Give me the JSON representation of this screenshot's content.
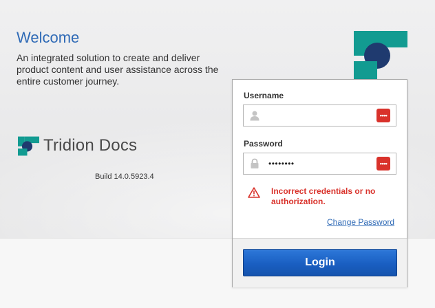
{
  "intro": {
    "title": "Welcome",
    "description": "An integrated solution to create and deliver product content and user assistance across the entire customer journey."
  },
  "brand": {
    "name": "Tridion Docs",
    "build": "Build 14.0.5923.4"
  },
  "login_form": {
    "username_label": "Username",
    "username_value": "",
    "password_label": "Password",
    "password_value": "••••••••",
    "password_manager_badge": "••••",
    "error_message": "Incorrect credentials or no authorization.",
    "change_password_link": "Change Password",
    "login_button": "Login"
  },
  "colors": {
    "accent_blue": "#2f6ab6",
    "error_red": "#d9322b",
    "logo_teal": "#129b91",
    "logo_navy": "#1f3a6f",
    "button_blue": "#1a5fc2"
  },
  "icons": {
    "username_field": "user-icon",
    "password_field": "lock-icon",
    "error": "warning-triangle-icon"
  }
}
